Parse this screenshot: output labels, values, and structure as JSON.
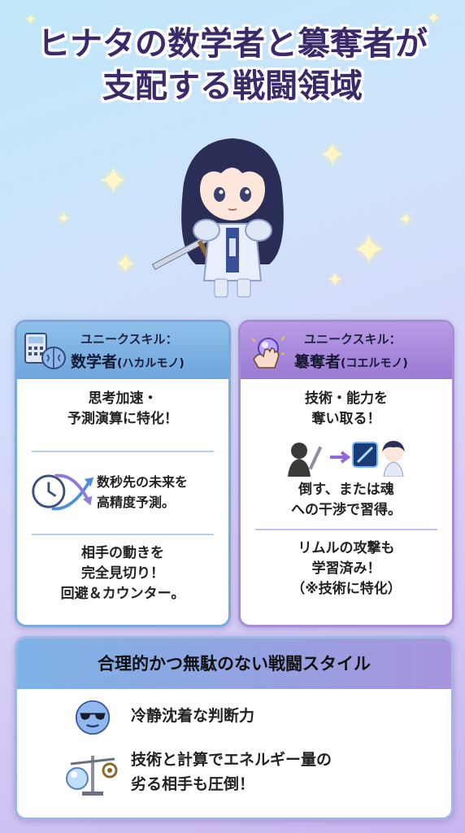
{
  "title": {
    "line1": "ヒナタの数学者と簒奪者が",
    "line2": "支配する戦闘領域"
  },
  "left_card": {
    "tag": "ユニークスキル：",
    "name": "数学者",
    "name_reading": "(ハカルモノ)",
    "s1": {
      "l1": "思考加速・",
      "l2": "予測演算に特化！"
    },
    "s2": {
      "l1": "数秒先の未来を",
      "l2": "高精度予測。"
    },
    "s3": {
      "l1": "相手の動きを",
      "l2": "完全見切り！",
      "l3": "回避＆カウンター。"
    }
  },
  "right_card": {
    "tag": "ユニークスキル：",
    "name": "簒奪者",
    "name_reading": "(コエルモノ)",
    "s1": {
      "l1": "技術・能力を",
      "l2": "奪い取る！"
    },
    "s2": {
      "l1": "倒す、または魂",
      "l2": "への干渉で習得。"
    },
    "s3": {
      "l1": "リムルの攻撃も",
      "l2": "学習済み！",
      "l3": "（※技術に特化）"
    }
  },
  "banner": {
    "heading": "合理的かつ無駄のない戦闘スタイル",
    "item1": "冷静沈着な判断力",
    "item2": {
      "l1": "技術と計算でエネルギー量の",
      "l2": "劣る相手も圧倒！"
    }
  },
  "icons": {
    "left_head": "calculator-brain-icon",
    "right_head": "grabbing-hand-orb-icon",
    "clock": "clock-arrows-icon",
    "absorb": "shadow-to-hinata-icon",
    "cool_face": "sunglasses-face-icon",
    "scale": "balance-scale-icon"
  },
  "colors": {
    "left_accent": "#7aa9dc",
    "right_accent": "#a98bd8",
    "title": "#3a2a6a"
  }
}
